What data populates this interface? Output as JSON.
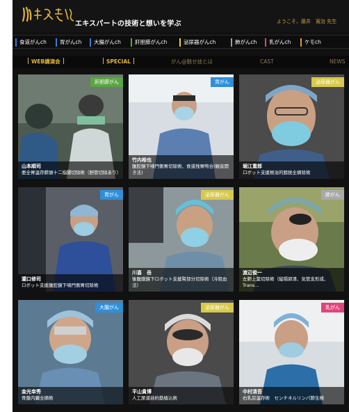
{
  "header": {
    "tagline": "エキスパートの技術と想いを学ぶ",
    "welcome": "ようこそ、藤井　寛治 先生"
  },
  "categories": [
    {
      "label": "食道がんch",
      "color": "#3a7bd5"
    },
    {
      "label": "胃がんch",
      "color": "#3a7bd5"
    },
    {
      "label": "大腸がんch",
      "color": "#3a7bd5"
    },
    {
      "label": "肝胆膵がんch",
      "color": "#4caf50"
    },
    {
      "label": "泌尿器がんch",
      "color": "#e6d23a"
    },
    {
      "label": "肺がんch",
      "color": "#9e9e9e"
    },
    {
      "label": "乳がんch",
      "color": "#e0457b"
    },
    {
      "label": "ケモch",
      "color": "#e09a2c"
    }
  ],
  "subnav": {
    "webinar": "WEB講演会",
    "special": "SPECIAL",
    "about": "がん@魅せ技とは",
    "cast": "CAST",
    "news": "NEWS"
  },
  "colors": {
    "liver": "#5aa642",
    "stomach": "#2f8fd8",
    "urology": "#d8c94a",
    "lung": "#a9a9a9",
    "colon": "#2f8fd8",
    "breast": "#e0457b"
  },
  "cards": [
    {
      "tag": "肝胆膵がん",
      "name": "山本順司",
      "desc": "亜全胃温存膵頭十二指腸切除術（胆管切除あり）"
    },
    {
      "tag": "胃がん",
      "name": "竹内裕也",
      "desc": "腹腔鏡下噴門側胃切除術、食道残胃吻合(観音開き法)"
    },
    {
      "tag": "泌尿器がん",
      "name": "堀江重郎",
      "desc": "ロボット支援根治的膀胱全摘除術"
    },
    {
      "tag": "胃がん",
      "name": "瀧口修司",
      "desc": "ロボット支援腹腔鏡下噴門側胃切除術"
    },
    {
      "tag": "泌尿器がん",
      "name": "川喜　岳",
      "desc": "後腹膜鏡下ロボット支援腎部分切除術（冷阻血法）"
    },
    {
      "tag": "肺がん",
      "name": "渡辺俊一",
      "desc": "左肺上葉切除術（縦隔郭清、気管支形成、Trans..."
    },
    {
      "tag": "大腸がん",
      "name": "金光幸秀",
      "desc": "骨盤内臓全摘術"
    },
    {
      "tag": "泌尿器がん",
      "name": "平山貴博",
      "desc": "人工尿道括約筋植込術"
    },
    {
      "tag": "乳がん",
      "name": "中村清吾",
      "desc": "右乳房温存術　センチネルリンパ節生検"
    }
  ]
}
